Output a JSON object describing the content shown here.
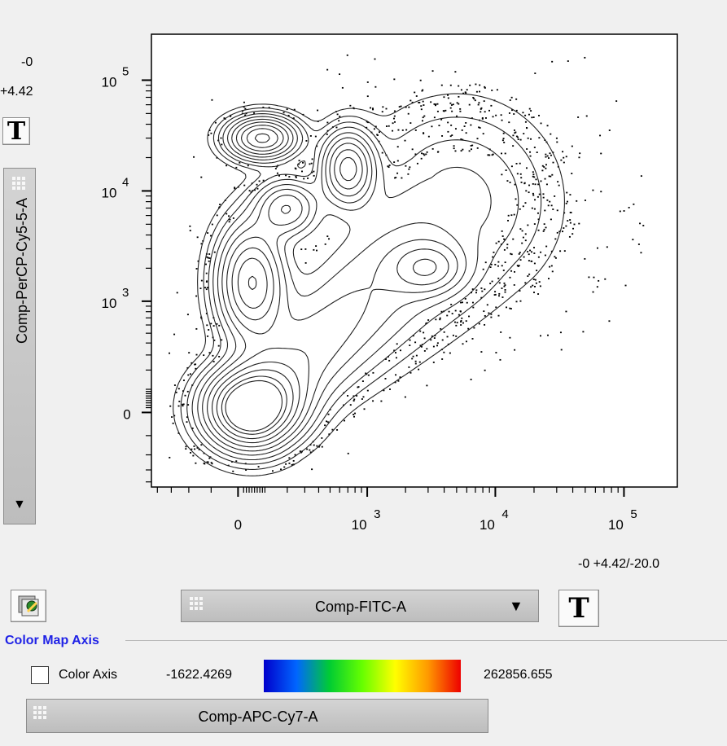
{
  "y_axis_panel": {
    "range_min": "-0",
    "range_max": "+4.42",
    "param_label": "Comp-PerCP-Cy5-5-A"
  },
  "x_axis_panel": {
    "range_text": "-0 +4.42/-20.0",
    "param_label": "Comp-FITC-A"
  },
  "toolbar": {
    "transform_glyph": "T"
  },
  "color_map": {
    "section_title": "Color Map Axis",
    "checkbox_label": "Color Axis",
    "checked": false,
    "min_value": "-1622.4269",
    "max_value": "262856.655",
    "param_label": "Comp-APC-Cy7-A",
    "gradient_colors": [
      "#0000cc",
      "#0066ff",
      "#00cc33",
      "#66ff00",
      "#ffff00",
      "#ff9900",
      "#ee0000"
    ]
  },
  "chart_data": {
    "type": "contour",
    "xlabel": "Comp-FITC-A",
    "ylabel": "Comp-PerCP-Cy5-5-A",
    "scale": "biexponential",
    "x_ticks": [
      {
        "label": "0",
        "exp": "",
        "value": 0
      },
      {
        "label": "10",
        "exp": "3",
        "value": 1000
      },
      {
        "label": "10",
        "exp": "4",
        "value": 10000
      },
      {
        "label": "10",
        "exp": "5",
        "value": 100000
      }
    ],
    "y_ticks": [
      {
        "label": "0",
        "exp": "",
        "value": 0
      },
      {
        "label": "10",
        "exp": "3",
        "value": 1000
      },
      {
        "label": "10",
        "exp": "4",
        "value": 10000
      },
      {
        "label": "10",
        "exp": "5",
        "value": 100000
      }
    ],
    "populations": [
      {
        "x": 50,
        "y": 20,
        "peak": 1.0
      },
      {
        "x": 50,
        "y": 1500,
        "peak": 0.8
      },
      {
        "x": 90,
        "y": 30000,
        "peak": 0.85
      },
      {
        "x": 700,
        "y": 16000,
        "peak": 0.7
      },
      {
        "x": 200,
        "y": 7000,
        "peak": 0.5
      },
      {
        "x": 3000,
        "y": 2000,
        "peak": 0.35
      }
    ]
  }
}
